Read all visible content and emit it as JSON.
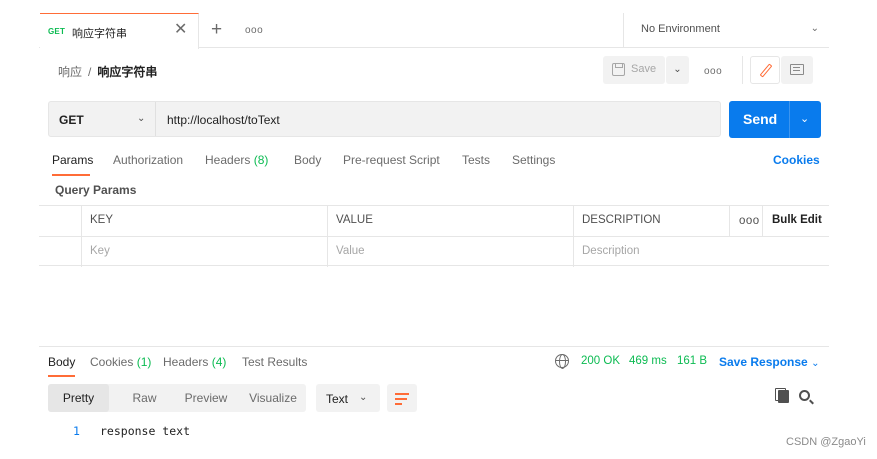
{
  "tab": {
    "method": "GET",
    "name": "响应字符串",
    "close": "✕"
  },
  "tabbar": {
    "new_tab": "+",
    "more": "ooo"
  },
  "environment": {
    "label": "No Environment",
    "chevron": "⌄"
  },
  "breadcrumb": {
    "collection": "响应",
    "separator": "/",
    "request": "响应字符串"
  },
  "toolbar": {
    "save_label": "Save",
    "save_chevron": "⌄",
    "more": "ooo"
  },
  "request": {
    "method": "GET",
    "method_chevron": "⌄",
    "url": "http://localhost/toText"
  },
  "send": {
    "label": "Send",
    "chevron": "⌄"
  },
  "request_tabs": {
    "params": "Params",
    "authorization": "Authorization",
    "headers": "Headers",
    "headers_count": "(8)",
    "body": "Body",
    "prerequest": "Pre-request Script",
    "tests": "Tests",
    "settings": "Settings",
    "cookies": "Cookies"
  },
  "query_params": {
    "title": "Query Params",
    "headers": {
      "key": "KEY",
      "value": "VALUE",
      "description": "DESCRIPTION",
      "more": "ooo",
      "bulk_edit": "Bulk Edit"
    },
    "placeholders": {
      "key": "Key",
      "value": "Value",
      "description": "Description"
    }
  },
  "response": {
    "tabs": {
      "body": "Body",
      "cookies": "Cookies",
      "cookies_count": "(1)",
      "headers": "Headers",
      "headers_count": "(4)",
      "test_results": "Test Results"
    },
    "status": "200 OK",
    "time": "469 ms",
    "size": "161 B",
    "save_response": "Save Response",
    "save_chevron": "⌄",
    "views": {
      "pretty": "Pretty",
      "raw": "Raw",
      "preview": "Preview",
      "visualize": "Visualize"
    },
    "format": "Text",
    "format_chevron": "⌄",
    "lines": [
      {
        "number": "1",
        "content": "response text"
      }
    ]
  },
  "watermark": "CSDN @ZgaoYi",
  "colors": {
    "accent": "#ff6c37",
    "primary": "#097bed",
    "success": "#0cbb52"
  },
  "icons": [
    "close-icon",
    "plus-icon",
    "more-icon",
    "chevron-down-icon",
    "save-icon",
    "edit-icon",
    "documentation-icon",
    "globe-icon",
    "wrap-lines-icon",
    "copy-icon",
    "search-icon"
  ]
}
